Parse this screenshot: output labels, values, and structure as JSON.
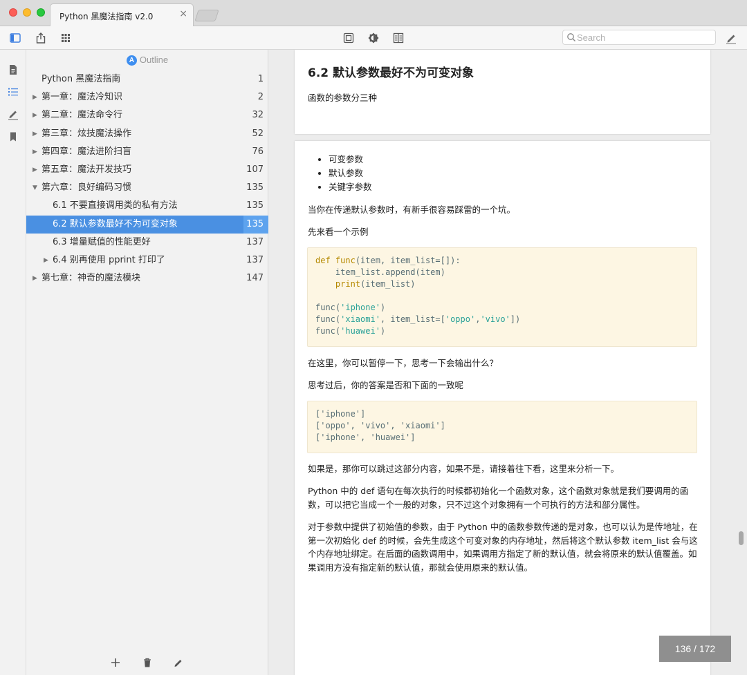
{
  "window": {
    "tab_title": "Python 黑魔法指南 v2.0",
    "tab_close": "×"
  },
  "toolbar": {
    "search_placeholder": "Search"
  },
  "outline": {
    "header": "Outline",
    "badge": "A",
    "items": [
      {
        "title": "Python 黑魔法指南",
        "page": "1",
        "level": 0,
        "caret": ""
      },
      {
        "title": "第一章：魔法冷知识",
        "page": "2",
        "level": 0,
        "caret": "▶"
      },
      {
        "title": "第二章：魔法命令行",
        "page": "32",
        "level": 0,
        "caret": "▶"
      },
      {
        "title": "第三章：炫技魔法操作",
        "page": "52",
        "level": 0,
        "caret": "▶"
      },
      {
        "title": "第四章：魔法进阶扫盲",
        "page": "76",
        "level": 0,
        "caret": "▶"
      },
      {
        "title": "第五章：魔法开发技巧",
        "page": "107",
        "level": 0,
        "caret": "▶"
      },
      {
        "title": "第六章：良好编码习惯",
        "page": "135",
        "level": 0,
        "caret": "▼"
      },
      {
        "title": "6.1 不要直接调用类的私有方法",
        "page": "135",
        "level": 1,
        "caret": ""
      },
      {
        "title": "6.2 默认参数最好不为可变对象",
        "page": "135",
        "level": 1,
        "caret": "",
        "active": true
      },
      {
        "title": "6.3 增量赋值的性能更好",
        "page": "137",
        "level": 1,
        "caret": ""
      },
      {
        "title": "6.4 别再使用 pprint 打印了",
        "page": "137",
        "level": 1,
        "caret": "▶"
      },
      {
        "title": "第七章：神奇的魔法模块",
        "page": "147",
        "level": 0,
        "caret": "▶"
      }
    ]
  },
  "document": {
    "heading": "6.2 默认参数最好不为可变对象",
    "intro": "函数的参数分三种",
    "bullets": [
      "可变参数",
      "默认参数",
      "关键字参数"
    ],
    "p1": "当你在传递默认参数时，有新手很容易踩雷的一个坑。",
    "p2": "先来看一个示例",
    "code1": {
      "line1_kw": "def",
      "line1_fn": "func",
      "line1_rest": "(item, item_list=[]):",
      "line2": "    item_list.append(item)",
      "line3_kw": "print",
      "line3_rest": "(item_list)",
      "line4_a": "func(",
      "line4_str": "'iphone'",
      "line4_b": ")",
      "line5_a": "func(",
      "line5_str1": "'xiaomi'",
      "line5_b": ", item_list=[",
      "line5_str2": "'oppo'",
      "line5_c": ",",
      "line5_str3": "'vivo'",
      "line5_d": "])",
      "line6_a": "func(",
      "line6_str": "'huawei'",
      "line6_b": ")"
    },
    "p3": "在这里，你可以暂停一下，思考一下会输出什么？",
    "p4": "思考过后，你的答案是否和下面的一致呢",
    "code2": "['iphone']\n['oppo', 'vivo', 'xiaomi']\n['iphone', 'huawei']",
    "p5": "如果是，那你可以跳过这部分内容，如果不是，请接着往下看，这里来分析一下。",
    "p6": "Python 中的 def 语句在每次执行的时候都初始化一个函数对象，这个函数对象就是我们要调用的函数，可以把它当成一个一般的对象，只不过这个对象拥有一个可执行的方法和部分属性。",
    "p7": "对于参数中提供了初始值的参数，由于 Python 中的函数参数传递的是对象，也可以认为是传地址，在第一次初始化 def 的时候，会先生成这个可变对象的内存地址，然后将这个默认参数 item_list 会与这个内存地址绑定。在后面的函数调用中，如果调用方指定了新的默认值，就会将原来的默认值覆盖。如果调用方没有指定新的默认值，那就会使用原来的默认值。"
  },
  "pager": "136 / 172"
}
